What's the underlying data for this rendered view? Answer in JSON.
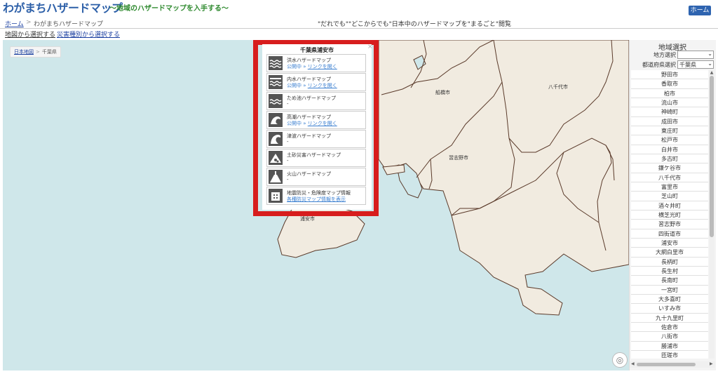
{
  "header": {
    "site_title": "わがまちハザードマップ",
    "site_subtitle": "～地域のハザードマップを入手する～",
    "home_button": "ホーム"
  },
  "breadcrumb": {
    "home": "ホーム",
    "separator": ">",
    "current": "わがまちハザードマップ"
  },
  "tagline": "\"だれでも\"\"どこからでも\"日本中のハザードマップを\"まるごと\"閲覧",
  "mode_links": {
    "by_map": "地図から選択する",
    "by_disaster": "災害種別から選択する"
  },
  "map": {
    "breadcrumb": {
      "link": "日本地図",
      "separator": ">",
      "current": "千葉県"
    },
    "city_labels": [
      "船橋市",
      "八千代市",
      "習志野市",
      "浦安市"
    ]
  },
  "popup": {
    "title": "千葉県浦安市",
    "close_glyph": "×",
    "items": [
      {
        "name": "洪水ハザードマップ",
        "published": "公開中",
        "link": "リンクを開く",
        "icon": "flood-icon"
      },
      {
        "name": "内水ハザードマップ",
        "published": "公開中",
        "link": "リンクを開く",
        "icon": "inland-flood-icon"
      },
      {
        "name": "ため池ハザードマップ",
        "status": "-",
        "icon": "reservoir-icon"
      },
      {
        "name": "高潮ハザードマップ",
        "published": "公開中",
        "link": "リンクを開く",
        "icon": "storm-surge-icon"
      },
      {
        "name": "津波ハザードマップ",
        "status": "-",
        "icon": "tsunami-icon"
      },
      {
        "name": "土砂災害ハザードマップ",
        "status": "-",
        "icon": "landslide-icon"
      },
      {
        "name": "火山ハザードマップ",
        "status": "-",
        "icon": "volcano-icon"
      },
      {
        "name": "地震防災・危険度マップ情報",
        "link": "各種防災マップ情報を表示",
        "icon": "earthquake-icon"
      }
    ],
    "separator": "»"
  },
  "sidebar": {
    "title": "地域選択",
    "region_label": "地方選択",
    "region_value": "",
    "prefecture_label": "都道府県選択",
    "prefecture_value": "千葉県",
    "municipalities": [
      "野田市",
      "香取市",
      "柏市",
      "流山市",
      "神崎町",
      "成田市",
      "東庄町",
      "松戸市",
      "白井市",
      "多古町",
      "鎌ケ谷市",
      "八千代市",
      "富里市",
      "芝山町",
      "酒々井町",
      "横芝光町",
      "習志野市",
      "四街道市",
      "浦安市",
      "大網白里市",
      "長柄町",
      "長生村",
      "長南町",
      "一宮町",
      "大多喜町",
      "いすみ市",
      "九十九里町",
      "佐倉市",
      "八街市",
      "勝浦市",
      "匝瑳市"
    ]
  },
  "colors": {
    "land": "#f1ebe0",
    "sea": "#cfe7ea",
    "border": "#5a3a2a",
    "highlight_frame": "#d71d1d",
    "title_blue": "#2c5fa8",
    "subtitle_green": "#2f8a2f"
  }
}
